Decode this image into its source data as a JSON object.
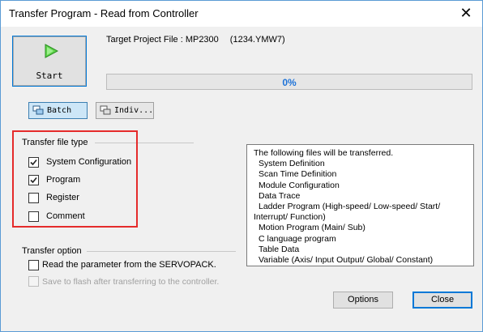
{
  "window": {
    "title": "Transfer Program - Read from Controller",
    "close_glyph": "✕"
  },
  "start_button": {
    "label": "Start",
    "icon": "play-icon"
  },
  "target": {
    "label": "Target Project File : MP2300",
    "file": "(1234.YMW7)"
  },
  "progress": {
    "value": 0,
    "text": "0%"
  },
  "mode_buttons": {
    "batch": "Batch",
    "individual": "Indiv..."
  },
  "transfer_file_type": {
    "title": "Transfer file type",
    "items": [
      {
        "label": "System Configuration",
        "checked": true
      },
      {
        "label": "Program",
        "checked": true
      },
      {
        "label": "Register",
        "checked": false
      },
      {
        "label": "Comment",
        "checked": false
      }
    ]
  },
  "transfer_option": {
    "title": "Transfer option",
    "items": [
      {
        "label": "Read the parameter from the SERVOPACK.",
        "checked": false,
        "enabled": true
      },
      {
        "label": "Save to flash after transferring to the controller.",
        "checked": false,
        "enabled": false
      }
    ]
  },
  "info": {
    "heading": "The following files will be transferred.",
    "lines": [
      "System Definition",
      "Scan Time Definition",
      "Module Configuration",
      "Data Trace",
      "Ladder Program (High-speed/ Low-speed/ Start/",
      "Interrupt/ Function)",
      "Motion Program (Main/ Sub)",
      "C language program",
      "Table Data",
      "Variable (Axis/ Input Output/ Global/ Constant)"
    ]
  },
  "footer": {
    "options": "Options",
    "close": "Close"
  },
  "colors": {
    "highlight": "#e52b2b",
    "accent": "#0078d7",
    "progress_text": "#1e73d8"
  }
}
